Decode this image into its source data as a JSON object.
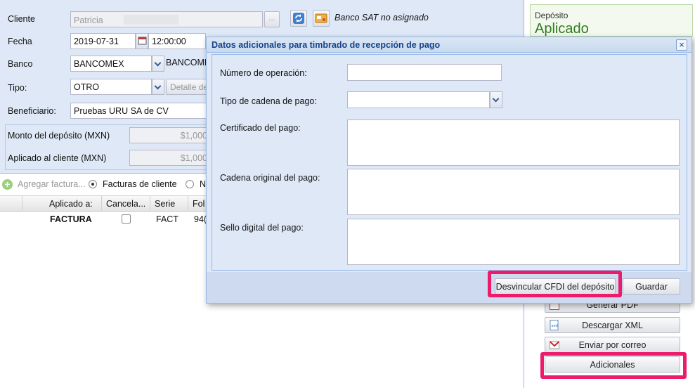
{
  "form": {
    "cliente": {
      "label": "Cliente",
      "value": "Patricia",
      "banco_sat_status": "Banco SAT no asignado"
    },
    "fecha": {
      "label": "Fecha",
      "date": "2019-07-31",
      "time": "12:00:00"
    },
    "banco": {
      "label": "Banco",
      "value": "BANCOMEX",
      "extra": "BANCOME"
    },
    "tipo": {
      "label": "Tipo:",
      "value": "OTRO",
      "detail_button": "Detalle de"
    },
    "beneficiario": {
      "label": "Beneficiario:",
      "value": "Pruebas URU SA de CV"
    },
    "monto_deposito": {
      "label": "Monto del depósito (MXN)",
      "value": "$1,000"
    },
    "aplicado_cliente": {
      "label": "Aplicado al cliente (MXN)",
      "value": "$1,000"
    }
  },
  "grid": {
    "toolbar": {
      "add_label": "Agregar factura...",
      "radio_facturas": "Facturas de cliente",
      "radio_other": "N"
    },
    "headers": [
      "Aplicado a:",
      "Cancela...",
      "Serie",
      "Fol"
    ],
    "rows": [
      {
        "aplicado": "FACTURA",
        "serie": "FACT",
        "folio": "94("
      }
    ]
  },
  "right_panel": {
    "status_caption": "Depósito",
    "status_value": "Aplicado",
    "buttons": {
      "generar_pdf": "Generar PDF",
      "descargar_xml": "Descargar XML",
      "enviar_correo": "Enviar por correo",
      "adicionales": "Adicionales"
    }
  },
  "dialog": {
    "title": "Datos adicionales para timbrado de recepción de pago",
    "close_glyph": "×",
    "fields": {
      "numero_operacion": "Número de operación:",
      "tipo_cadena": "Tipo de cadena de pago:",
      "certificado": "Certificado del pago:",
      "cadena_original": "Cadena original del pago:",
      "sello_digital": "Sello digital del pago:"
    },
    "buttons": {
      "desvincular": "Desvincular CFDI del depósito",
      "guardar": "Guardar"
    }
  },
  "colors": {
    "highlight": "#ec1c6a",
    "status_green": "#2e7d1f",
    "title_blue": "#15428b"
  }
}
